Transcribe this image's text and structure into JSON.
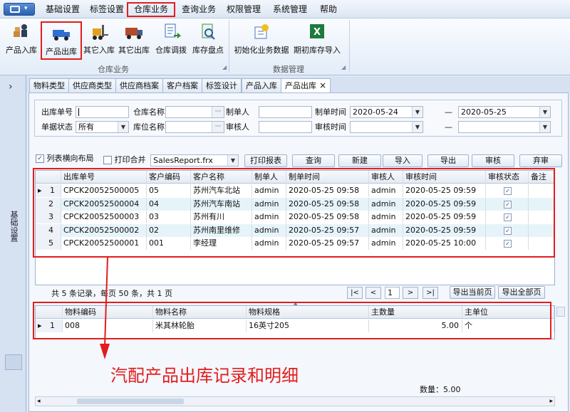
{
  "menubar": {
    "app_button_caret": "▾",
    "items": [
      "基础设置",
      "标签设置",
      "仓库业务",
      "查询业务",
      "权限管理",
      "系统管理",
      "帮助"
    ]
  },
  "ribbon": {
    "buttons": [
      "产品入库",
      "产品出库",
      "其它入库",
      "其它出库",
      "仓库调拨",
      "库存盘点",
      "初始化业务数据",
      "期初库存导入"
    ],
    "groups": [
      "仓库业务",
      "数据管理"
    ]
  },
  "left_panel": {
    "expand_glyph": "›",
    "label": "基础设置"
  },
  "tabs": [
    "物料类型",
    "供应商类型",
    "供应商档案",
    "客户档案",
    "标签设计",
    "产品入库",
    "产品出库"
  ],
  "tab_close": "×",
  "filters": {
    "labels": [
      "出库单号",
      "仓库名称",
      "制单人",
      "制单时间",
      "单据状态",
      "库位名称",
      "审核人",
      "审核时间"
    ],
    "status_value": "所有",
    "date_from": "2020-05-24",
    "date_to": "2020-05-25",
    "dash": "—",
    "ellipsis": "···"
  },
  "toolbar": {
    "layout_check": "列表横向布局",
    "merge_print": "打印合并",
    "report_file": "SalesReport.frx",
    "buttons": [
      "打印报表",
      "查询",
      "新建",
      "导入",
      "导出",
      "审核",
      "弃审"
    ]
  },
  "main_grid": {
    "columns": [
      "出库单号",
      "客户编码",
      "客户名称",
      "制单人",
      "制单时间",
      "审核人",
      "审核时间",
      "审核状态",
      "备注"
    ],
    "rows": [
      {
        "no": "1",
        "id": "CPCK20052500005",
        "code": "05",
        "name": "苏州汽车北站",
        "maker": "admin",
        "made": "2020-05-25 09:58",
        "auditor": "admin",
        "audited": "2020-05-25 09:59",
        "ok": "✓"
      },
      {
        "no": "2",
        "id": "CPCK20052500004",
        "code": "04",
        "name": "苏州汽车南站",
        "maker": "admin",
        "made": "2020-05-25 09:58",
        "auditor": "admin",
        "audited": "2020-05-25 09:59",
        "ok": "✓"
      },
      {
        "no": "3",
        "id": "CPCK20052500003",
        "code": "03",
        "name": "苏州有川",
        "maker": "admin",
        "made": "2020-05-25 09:58",
        "auditor": "admin",
        "audited": "2020-05-25 09:59",
        "ok": "✓"
      },
      {
        "no": "4",
        "id": "CPCK20052500002",
        "code": "02",
        "name": "苏州南里维修",
        "maker": "admin",
        "made": "2020-05-25 09:57",
        "auditor": "admin",
        "audited": "2020-05-25 09:59",
        "ok": "✓"
      },
      {
        "no": "5",
        "id": "CPCK20052500001",
        "code": "001",
        "name": "李经理",
        "maker": "admin",
        "made": "2020-05-25 09:57",
        "auditor": "admin",
        "audited": "2020-05-25 10:00",
        "ok": "✓"
      }
    ]
  },
  "pager": {
    "summary": "共 5 条记录，每页 50 条，共 1 页",
    "first": "|<",
    "prev": "<",
    "page": "1",
    "next": ">",
    "last": ">|",
    "export_current": "导出当前页",
    "export_all": "导出全部页"
  },
  "detail_grid": {
    "columns": [
      "物料编码",
      "物料名称",
      "物料规格",
      "主数量",
      "主单位"
    ],
    "rows": [
      {
        "no": "1",
        "code": "008",
        "name": "米其林轮胎",
        "spec": "16英寸205",
        "qty": "5.00",
        "unit": "个"
      }
    ]
  },
  "annotation": "汽配产品出库记录和明细",
  "footer": {
    "quantity": "数量：5.00"
  },
  "colors": {
    "highlight": "#e21d1d",
    "annotation": "#e21d1d",
    "row_odd": "#ffffff",
    "row_even": "#e6f4fa"
  }
}
